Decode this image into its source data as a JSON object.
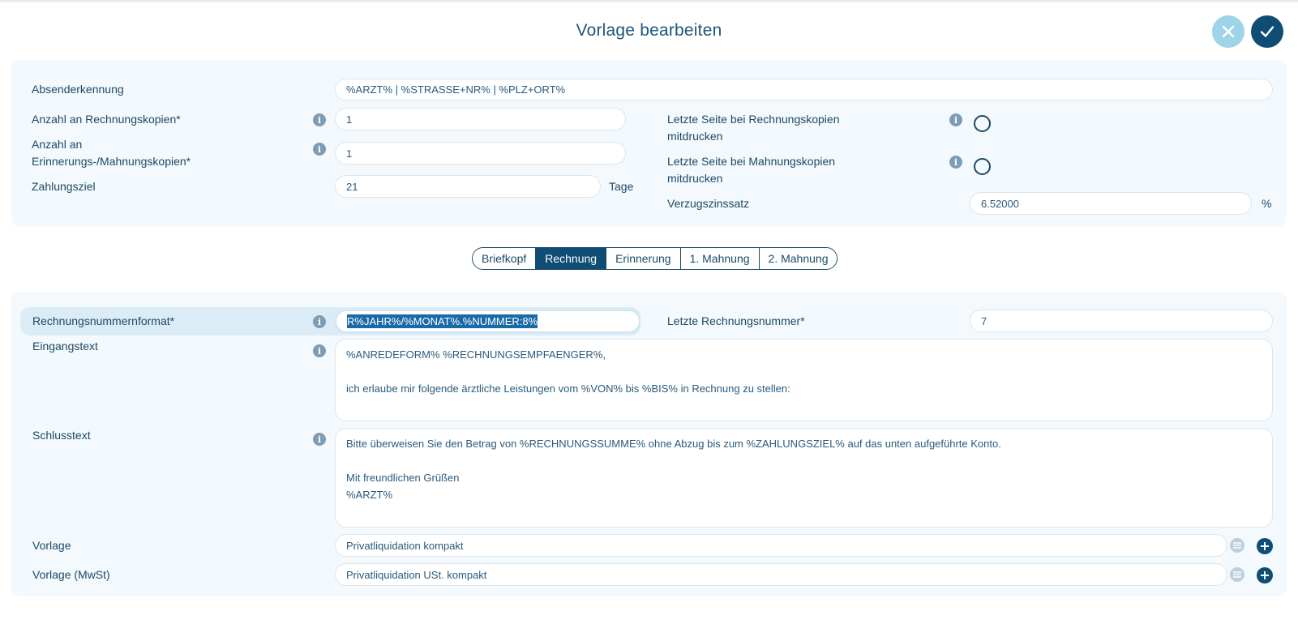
{
  "dialog": {
    "title": "Vorlage bearbeiten"
  },
  "top_section": {
    "sender_id": {
      "label": "Absenderkennung",
      "value": "%ARZT% | %STRASSE+NR% | %PLZ+ORT%"
    },
    "invoice_copies": {
      "label": "Anzahl an Rechnungskopien*",
      "value": "1"
    },
    "reminder_copies": {
      "label_line1": "Anzahl an",
      "label_line2": "Erinnerungs-/Mahnungskopien*",
      "value": "1"
    },
    "payment_term": {
      "label": "Zahlungsziel",
      "value": "21",
      "unit": "Tage"
    },
    "print_last_page_invoice": {
      "label_line1": "Letzte Seite bei Rechnungskopien",
      "label_line2": "mitdrucken"
    },
    "print_last_page_dunning": {
      "label_line1": "Letzte Seite bei Mahnungskopien",
      "label_line2": "mitdrucken"
    },
    "interest_rate": {
      "label": "Verzugszinssatz",
      "value": "6.52000",
      "unit": "%"
    }
  },
  "tabs": [
    {
      "label": "Briefkopf",
      "active": false
    },
    {
      "label": "Rechnung",
      "active": true
    },
    {
      "label": "Erinnerung",
      "active": false
    },
    {
      "label": "1. Mahnung",
      "active": false
    },
    {
      "label": "2. Mahnung",
      "active": false
    }
  ],
  "invoice_section": {
    "number_format": {
      "label": "Rechnungsnummernformat*",
      "value": "R%JAHR%/%MONAT%.%NUMMER:8%"
    },
    "last_number": {
      "label": "Letzte Rechnungsnummer*",
      "value": "7"
    },
    "intro_text": {
      "label": "Eingangstext",
      "lines": [
        "%ANREDEFORM% %RECHNUNGSEMPFAENGER%,",
        "",
        "ich erlaube mir folgende ärztliche Leistungen vom %VON% bis %BIS% in Rechnung zu stellen:"
      ]
    },
    "closing_text": {
      "label": "Schlusstext",
      "lines": [
        "Bitte überweisen Sie den Betrag von %RECHNUNGSSUMME% ohne Abzug bis zum %ZAHLUNGSZIEL% auf das unten aufgeführte Konto.",
        "",
        "Mit freundlichen Grüßen",
        "%ARZT%"
      ]
    },
    "template": {
      "label": "Vorlage",
      "value": "Privatliquidation kompakt"
    },
    "template_vat": {
      "label": "Vorlage (MwSt)",
      "value": "Privatliquidation USt. kompakt"
    }
  },
  "icons": {
    "cancel": "close-icon",
    "confirm": "check-icon",
    "info": "info-icon",
    "list": "list-icon",
    "add": "plus-icon"
  },
  "colors": {
    "primary": "#0f4d75",
    "cancel": "#9fd3e8",
    "panel": "#f3f9fd",
    "highlight": "#dbecf6",
    "text": "#1c4966"
  }
}
